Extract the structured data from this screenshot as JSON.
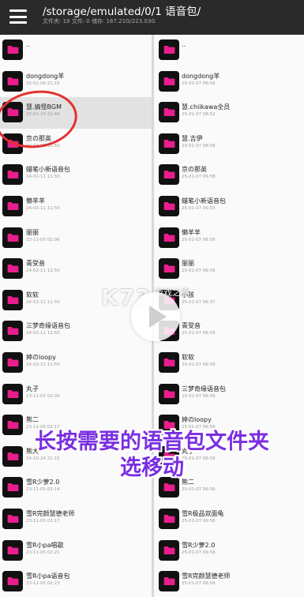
{
  "header": {
    "path": "/storage/emulated/0/1 语音包/",
    "stats": "文件夹: 19   文件: 0   储存: 167.21G/223.03G"
  },
  "left_pane": [
    {
      "name": "..",
      "date": ""
    },
    {
      "name": "dongdong羊",
      "date": "25-01-06 21:10"
    },
    {
      "name": "慧.搞怪BGM",
      "date": "25-01-20 21:40",
      "selected": true
    },
    {
      "name": "京の那英",
      "date": "24-02-11 11:50"
    },
    {
      "name": "蜡笔小新语音包",
      "date": "24-02-11 11:50"
    },
    {
      "name": "懒羊羊",
      "date": "24-02-11 11:50"
    },
    {
      "name": "丽丽",
      "date": "23-11-05 02:06"
    },
    {
      "name": "青受音",
      "date": "24-02-11 11:50"
    },
    {
      "name": "软软",
      "date": "24-02-11 11:50"
    },
    {
      "name": "三梦奇缘语音包",
      "date": "24-02-11 11:50"
    },
    {
      "name": "婷のloopy",
      "date": "24-02-11 11:50"
    },
    {
      "name": "丸子",
      "date": "23-11-05 02:09"
    },
    {
      "name": "熊二",
      "date": "23-11-05 02:17"
    },
    {
      "name": "熊大",
      "date": "24-10-24 21:15"
    },
    {
      "name": "雪R少萝2.0",
      "date": "23-11-05 02:14"
    },
    {
      "name": "雪R完颜慧德老师",
      "date": "23-11-05 02:17"
    },
    {
      "name": "雪R小pa唱歌",
      "date": "23-11-05 02:21"
    },
    {
      "name": "雪R小pa语音包",
      "date": "23-11-05 02:23"
    }
  ],
  "right_pane": [
    {
      "name": "..",
      "date": ""
    },
    {
      "name": "dongdong羊",
      "date": "25-01-07 06:56"
    },
    {
      "name": "慧.chiikawa全员",
      "date": "25-01-07 08:52"
    },
    {
      "name": "慧.吉伊",
      "date": "25-01-07 08:56"
    },
    {
      "name": "京の那英",
      "date": "25-01-07 06:58"
    },
    {
      "name": "蜡笔小新语音包",
      "date": "25-01-07 06:53"
    },
    {
      "name": "懒羊羊",
      "date": "25-01-07 06:56"
    },
    {
      "name": "丽丽",
      "date": "25-01-07 06:56"
    },
    {
      "name": "小孩",
      "date": "25-01-07 06:37"
    },
    {
      "name": "青受音",
      "date": "25-01-07 06:56"
    },
    {
      "name": "软软",
      "date": "25-01-07 06:56"
    },
    {
      "name": "三梦奇缘语音包",
      "date": "25-01-07 06:56"
    },
    {
      "name": "婷のloopy",
      "date": "25-01-07 06:56"
    },
    {
      "name": "丸子",
      "date": "25-01-07 06:56"
    },
    {
      "name": "熊二",
      "date": "25-01-07 06:56"
    },
    {
      "name": "雪R极品双面龟",
      "date": "25-01-07 06:56"
    },
    {
      "name": "雪R少萝2.0",
      "date": "25-01-07 06:56"
    },
    {
      "name": "雪R完颜慧德老师",
      "date": "25-01-07 06:56"
    }
  ],
  "overlay": {
    "watermark": "K73",
    "watermark_sub": "游戏之家",
    "caption_line1": "长按需要的语音包文件夹",
    "caption_line2": "选移动"
  },
  "icons": {
    "menu": "hamburger-menu-icon",
    "folder": "folder-icon",
    "play": "play-icon"
  },
  "colors": {
    "topbar": "#2a2a2a",
    "folder_pink": "#e91e8c",
    "caption": "#7a2fe0",
    "annotation": "#e53030"
  }
}
